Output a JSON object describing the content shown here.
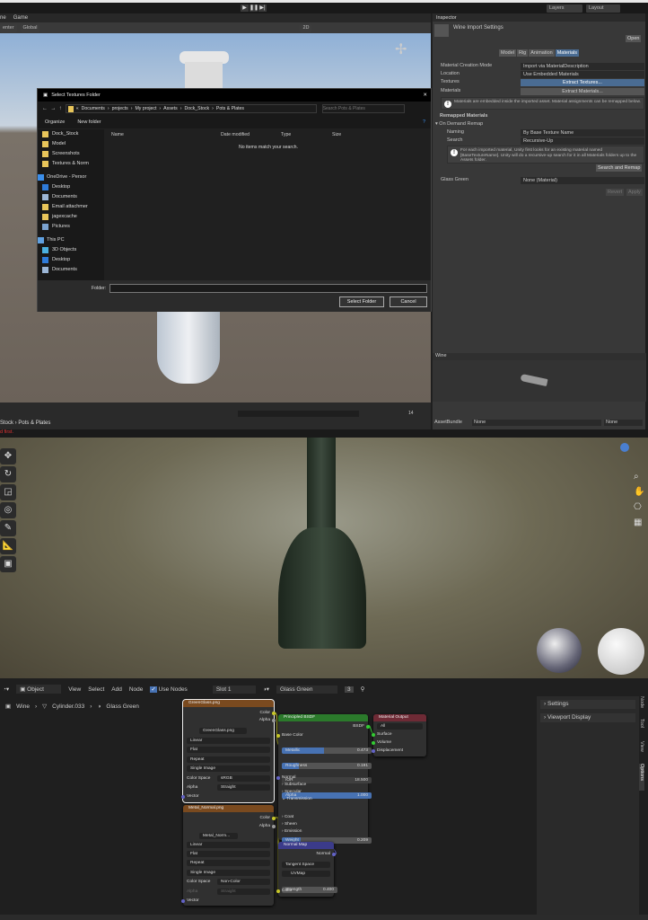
{
  "unity": {
    "tabs": {
      "scene": "ne",
      "game": "Game"
    },
    "toolbar": {
      "pivot": "enter",
      "space": "Global",
      "twod": "2D"
    },
    "top_right": {
      "layers": "Layers",
      "layout": "Layout"
    },
    "project": {
      "breadcrumb": [
        "Stock",
        "Pots & Plates"
      ],
      "visible_count": "14"
    },
    "console_error": "d first."
  },
  "dialog": {
    "title": "Select Textures Folder",
    "path": [
      "Documents",
      "projects",
      "My project",
      "Assets",
      "Dock_Stock",
      "Pots & Plates"
    ],
    "search_placeholder": "Search Pots & Plates",
    "organize": "Organize",
    "new_folder": "New folder",
    "nav": [
      {
        "label": "Dock_Stock",
        "icon": "folder"
      },
      {
        "label": "Model",
        "icon": "folder"
      },
      {
        "label": "Screenshots",
        "icon": "folder"
      },
      {
        "label": "Textures & Norm",
        "icon": "folder"
      },
      {
        "label": "OneDrive - Persor",
        "icon": "cloud"
      },
      {
        "label": "Desktop",
        "icon": "desktop"
      },
      {
        "label": "Documents",
        "icon": "document"
      },
      {
        "label": "Email attachmer",
        "icon": "folder"
      },
      {
        "label": "jagexcache",
        "icon": "folder"
      },
      {
        "label": "Pictures",
        "icon": "pictures"
      },
      {
        "label": "This PC",
        "icon": "pc"
      },
      {
        "label": "3D Objects",
        "icon": "cube"
      },
      {
        "label": "Desktop",
        "icon": "desktop"
      },
      {
        "label": "Documents",
        "icon": "document"
      }
    ],
    "columns": [
      "Name",
      "Date modified",
      "Type",
      "Size"
    ],
    "empty_message": "No items match your search.",
    "folder_label": "Folder:",
    "folder_value": "",
    "select_button": "Select Folder",
    "cancel_button": "Cancel"
  },
  "inspector": {
    "tab": "Inspector",
    "title": "Wine Import Settings",
    "open": "Open",
    "subtabs": [
      "Model",
      "Rig",
      "Animation",
      "Materials"
    ],
    "active_subtab": "Materials",
    "fields": [
      {
        "label": "Material Creation Mode",
        "value": "Import via MaterialDescription"
      },
      {
        "label": "Location",
        "value": "Use Embedded Materials"
      },
      {
        "label": "Textures",
        "value": "Extract Textures..."
      },
      {
        "label": "Materials",
        "value": "Extract Materials..."
      }
    ],
    "help1": "Materials are embedded inside the imported asset. Material assignments can be remapped below.",
    "remapped_header": "Remapped Materials",
    "on_demand": "On Demand Remap",
    "naming_label": "Naming",
    "naming_value": "By Base Texture Name",
    "search_label": "Search",
    "search_value": "Recursive-Up",
    "help2": "For each imported material, Unity first looks for an existing material named [BaseTextureName]. Unity will do a recursive-up search for it in all Materials folders up to the Assets folder.",
    "search_remap": "Search and Remap",
    "glass_label": "Glass Green",
    "glass_value": "None (Material)",
    "revert": "Revert",
    "apply": "Apply",
    "preview_title": "Wine",
    "assetbundle_label": "AssetBundle",
    "assetbundle_value": "None",
    "variant_value": "None"
  },
  "blender": {
    "header": {
      "mode": "Object",
      "menus": [
        "View",
        "Select",
        "Add",
        "Node"
      ],
      "use_nodes": "Use Nodes",
      "use_nodes_checked": true,
      "slot": "Slot 1",
      "material": "Glass Green",
      "users": "3"
    },
    "breadcrumb": [
      "Wine",
      "Cylinder.033",
      "Glass Green"
    ],
    "sidebar": {
      "panels": [
        "Settings",
        "Viewport Display"
      ],
      "tabs": [
        "Node",
        "Tool",
        "View",
        "Options"
      ]
    },
    "nodes": {
      "tex1": {
        "title": "GreenGlass.png",
        "image": "GreenGlass.png",
        "outputs": [
          "Color",
          "Alpha"
        ],
        "interp": "Linear",
        "proj": "Flat",
        "ext": "Repeat",
        "source": "Single Image",
        "cs_label": "Color Space",
        "cs": "sRGB",
        "alpha_label": "Alpha",
        "alpha": "Straight",
        "input": "Vector"
      },
      "tex2": {
        "title": "Metal_Normal.png",
        "image": "Metal_Norm...",
        "outputs": [
          "Color",
          "Alpha"
        ],
        "interp": "Linear",
        "proj": "Flat",
        "ext": "Repeat",
        "source": "Single Image",
        "cs_label": "Color Space",
        "cs": "Non-Color",
        "alpha_label": "Alpha",
        "alpha": "Straight",
        "input": "Vector"
      },
      "bsdf": {
        "title": "Principled BSDF",
        "output": "BSDF",
        "base_color": "Base Color",
        "sliders": [
          {
            "label": "Metallic",
            "value": "0.473",
            "fill": 0.473
          },
          {
            "label": "Roughness",
            "value": "0.191",
            "fill": 0.191
          },
          {
            "label": "IOR",
            "value": "18.500",
            "fill": 0
          },
          {
            "label": "Alpha",
            "value": "1.000",
            "fill": 1
          }
        ],
        "normal": "Normal",
        "subs": [
          "Subsurface",
          "Specular",
          "Transmission"
        ],
        "weight_label": "Weight",
        "weight": "0.209",
        "weight_fill": 0.209,
        "subs2": [
          "Coat",
          "Sheen",
          "Emission"
        ]
      },
      "output": {
        "title": "Material Output",
        "target": "All",
        "inputs": [
          "Surface",
          "Volume",
          "Displacement"
        ]
      },
      "normalmap": {
        "title": "Normal Map",
        "output": "Normal",
        "space": "Tangent Space",
        "uv": "UVMap",
        "strength_label": "Strength",
        "strength": "0.400",
        "input": "Color"
      }
    }
  }
}
